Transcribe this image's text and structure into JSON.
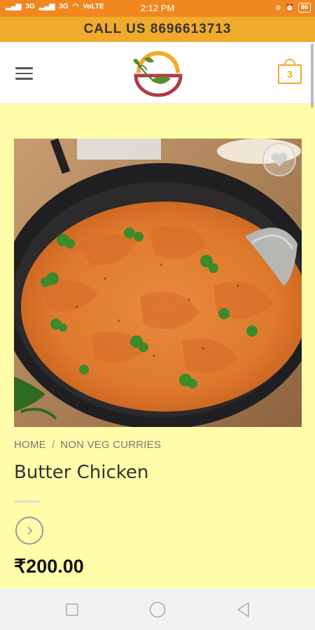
{
  "status_bar": {
    "signal_1": "3G",
    "signal_2": "3G",
    "volte": "VoLTE",
    "time": "2:12 PM",
    "battery": "86"
  },
  "call_bar": {
    "text": "CALL US 8696613713"
  },
  "header": {
    "menu_icon": "hamburger-icon",
    "logo_icon": "restaurant-logo",
    "cart_count": "3"
  },
  "product": {
    "image_icon": "butter-chicken-photo",
    "breadcrumb": {
      "home": "HOME",
      "separator": "/",
      "category": "NON VEG CURRIES"
    },
    "title": "Butter Chicken",
    "price": "₹200.00"
  },
  "colors": {
    "status_bar": "#f0881f",
    "call_bar": "#f0ab2a",
    "page_background": "#fffcaa",
    "cart_accent": "#f0ab2a"
  }
}
